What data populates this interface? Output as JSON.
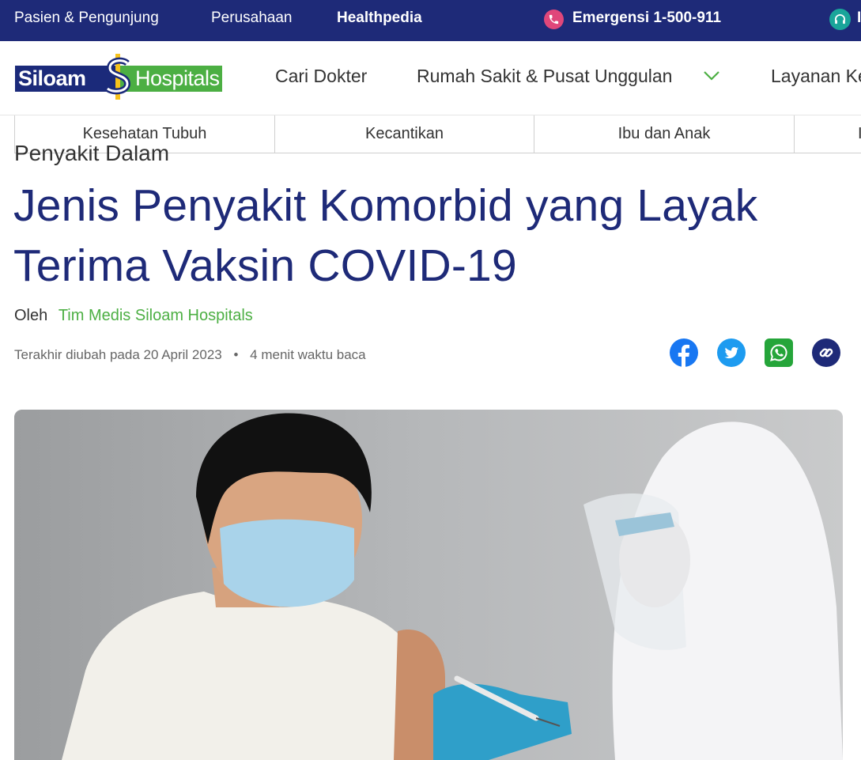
{
  "topbar": {
    "patients": "Pasien & Pengunjung",
    "company": "Perusahaan",
    "healthpedia": "Healthpedia",
    "emergency": "Emergensi 1-500-911",
    "cut_text": "I",
    "colors": {
      "bg": "#1e2a78",
      "phone": "#e0477a",
      "support": "#1aa59a"
    }
  },
  "nav": {
    "logo_left": "Siloam",
    "logo_right": "Hospitals",
    "find_doctor": "Cari Dokter",
    "hospitals": "Rumah Sakit & Pusat Unggulan",
    "services": "Layanan Ke"
  },
  "tabs": [
    "Kesehatan Tubuh",
    "Kecantikan",
    "Ibu dan Anak",
    "I"
  ],
  "article": {
    "category": "Penyakit Dalam",
    "title_line1": "Jenis Penyakit Komorbid yang Layak",
    "title_line2": "Terima Vaksin COVID-19",
    "by_label": "Oleh",
    "author": "Tim Medis Siloam Hospitals",
    "updated": "Terakhir diubah pada 20 April 2023",
    "read_time": "4 menit waktu baca"
  },
  "share_icons": [
    "facebook-icon",
    "twitter-icon",
    "whatsapp-icon",
    "link-icon"
  ],
  "colors": {
    "navy": "#1e2a78",
    "green": "#4caf43"
  }
}
